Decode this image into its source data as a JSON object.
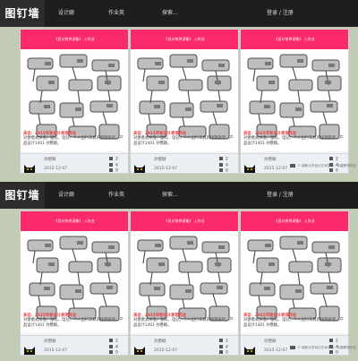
{
  "nav": {
    "logo": "图钉墙",
    "items": [
      "设计廊",
      "作业英",
      "探索..."
    ],
    "login": "登录 / 注册"
  },
  "card": {
    "header": "《设计快供读衡》 入作业",
    "title": "来自：2015年秋设计表现作业",
    "description": "对便携式水壶、鼠标、电钻、个人出行工具的快题表现，产品设计1401 孙懋颖。",
    "author": "孙懋颖",
    "date": "2015-12-07",
    "stats": [
      "2",
      "4",
      "0"
    ]
  },
  "footer": "© 南阳大学设计艺术学院 · 华建教授作品"
}
